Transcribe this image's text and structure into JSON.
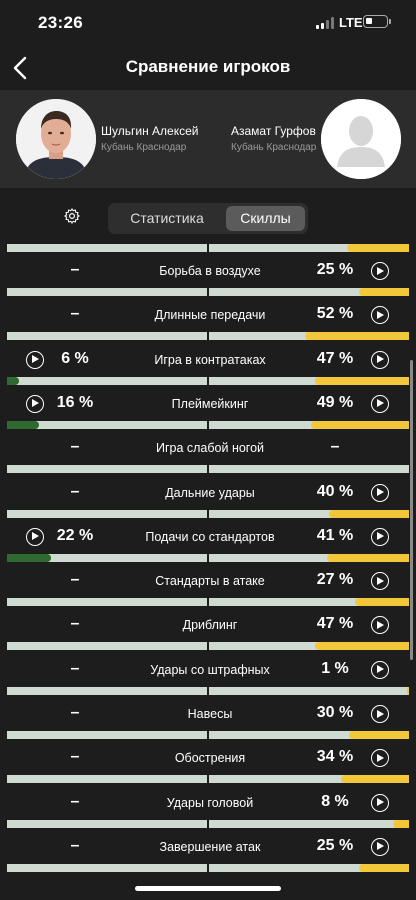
{
  "status_bar": {
    "time": "23:26",
    "network": "LTE"
  },
  "nav": {
    "title": "Сравнение игроков"
  },
  "players": [
    {
      "name": "Шульгин Алексей",
      "team": "Кубань Краснодар"
    },
    {
      "name": "Азамат Гурфов",
      "team": "Кубань Краснодар"
    }
  ],
  "tabs": [
    {
      "label": "Статистика",
      "active": false
    },
    {
      "label": "Скиллы",
      "active": true
    }
  ],
  "colors": {
    "left_bar": "#2e6a2f",
    "right_bar": "#f2c73a",
    "bar_track": "#cfdad0"
  },
  "skills": [
    {
      "name": "Борьба в воздухе",
      "left": "–",
      "right": "25 %",
      "left_pct": 0,
      "right_pct": 25,
      "left_play": false,
      "right_play": true
    },
    {
      "name": "Длинные передачи",
      "left": "–",
      "right": "52 %",
      "left_pct": 0,
      "right_pct": 52,
      "left_play": false,
      "right_play": true
    },
    {
      "name": "Игра в контратаках",
      "left": "6 %",
      "right": "47 %",
      "left_pct": 6,
      "right_pct": 47,
      "left_play": true,
      "right_play": true
    },
    {
      "name": "Плеймейкинг",
      "left": "16 %",
      "right": "49 %",
      "left_pct": 16,
      "right_pct": 49,
      "left_play": true,
      "right_play": true
    },
    {
      "name": "Игра слабой ногой",
      "left": "–",
      "right": "–",
      "left_pct": 0,
      "right_pct": 0,
      "left_play": false,
      "right_play": false
    },
    {
      "name": "Дальние удары",
      "left": "–",
      "right": "40 %",
      "left_pct": 0,
      "right_pct": 40,
      "left_play": false,
      "right_play": true
    },
    {
      "name": "Подачи со стандартов",
      "left": "22 %",
      "right": "41 %",
      "left_pct": 22,
      "right_pct": 41,
      "left_play": true,
      "right_play": true
    },
    {
      "name": "Стандарты в атаке",
      "left": "–",
      "right": "27 %",
      "left_pct": 0,
      "right_pct": 27,
      "left_play": false,
      "right_play": true
    },
    {
      "name": "Дриблинг",
      "left": "–",
      "right": "47 %",
      "left_pct": 0,
      "right_pct": 47,
      "left_play": false,
      "right_play": true
    },
    {
      "name": "Удары со штрафных",
      "left": "–",
      "right": "1 %",
      "left_pct": 0,
      "right_pct": 1,
      "left_play": false,
      "right_play": true
    },
    {
      "name": "Навесы",
      "left": "–",
      "right": "30 %",
      "left_pct": 0,
      "right_pct": 30,
      "left_play": false,
      "right_play": true
    },
    {
      "name": "Обострения",
      "left": "–",
      "right": "34 %",
      "left_pct": 0,
      "right_pct": 34,
      "left_play": false,
      "right_play": true
    },
    {
      "name": "Удары головой",
      "left": "–",
      "right": "8 %",
      "left_pct": 0,
      "right_pct": 8,
      "left_play": false,
      "right_play": true
    },
    {
      "name": "Завершение атак",
      "left": "–",
      "right": "25 %",
      "left_pct": 0,
      "right_pct": 25,
      "left_play": false,
      "right_play": true
    }
  ]
}
